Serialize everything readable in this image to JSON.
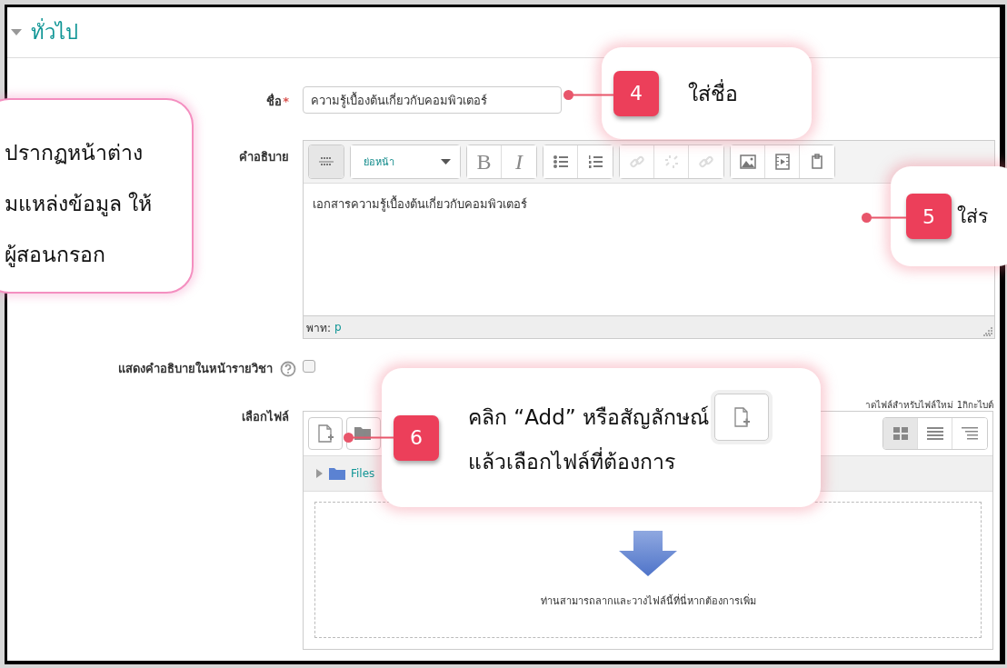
{
  "section": {
    "title": "ทั่วไป",
    "expanded": true
  },
  "name_field": {
    "label": "ชื่อ",
    "required_mark": "*",
    "value": "ความรู้เบื้องต้นเกี่ยวกับคอมพิวเตอร์"
  },
  "description": {
    "label": "คำอธิบาย",
    "format": "ย่อหน้า",
    "content": "เอกสารความรู้เบื้องต้นเกี่ยวกับคอมพิวเตอร์",
    "path_label": "พาท:",
    "path_value": "p",
    "toolbar": [
      {
        "kind": "toggle"
      },
      {
        "kind": "format"
      },
      {
        "kind": "bold",
        "label": "B"
      },
      {
        "kind": "italic",
        "label": "I"
      },
      {
        "kind": "bullets"
      },
      {
        "kind": "numbers"
      },
      {
        "kind": "link",
        "disabled": true
      },
      {
        "kind": "unlink",
        "disabled": true
      },
      {
        "kind": "link",
        "disabled": true
      },
      {
        "kind": "image"
      },
      {
        "kind": "media"
      },
      {
        "kind": "paste"
      }
    ]
  },
  "show_description": {
    "label": "แสดงคำอธิบายในหน้ารายวิชา",
    "checked": false
  },
  "file_picker": {
    "label": "เลือกไฟล์",
    "max_size_note": "าดไฟล์สำหรับไฟล์ใหม่ 1กิกะไบต์",
    "path": "Files",
    "drop_hint": "ท่านสามารถลากและวางไฟล์นี้ที่นี่หากต้องการเพิ่ม",
    "views": [
      {
        "kind": "grid",
        "selected": true
      },
      {
        "kind": "list",
        "selected": false
      },
      {
        "kind": "tree",
        "selected": false
      }
    ]
  },
  "callouts": [
    {
      "lines": [
        "ปรากฏหน้าต่าง",
        "มแหล่งข้อมูล ให้",
        "ผู้สอนกรอก"
      ]
    },
    {
      "number": "4",
      "lines": [
        "ใส่ชื่อ"
      ]
    },
    {
      "number": "5",
      "lines": [
        "ใส่ร"
      ]
    },
    {
      "number": "6",
      "lines": [
        "คลิก “Add” หรือสัญลักษณ์",
        "แล้วเลือกไฟล์ที่ต้องการ"
      ],
      "file_icon": true
    }
  ]
}
